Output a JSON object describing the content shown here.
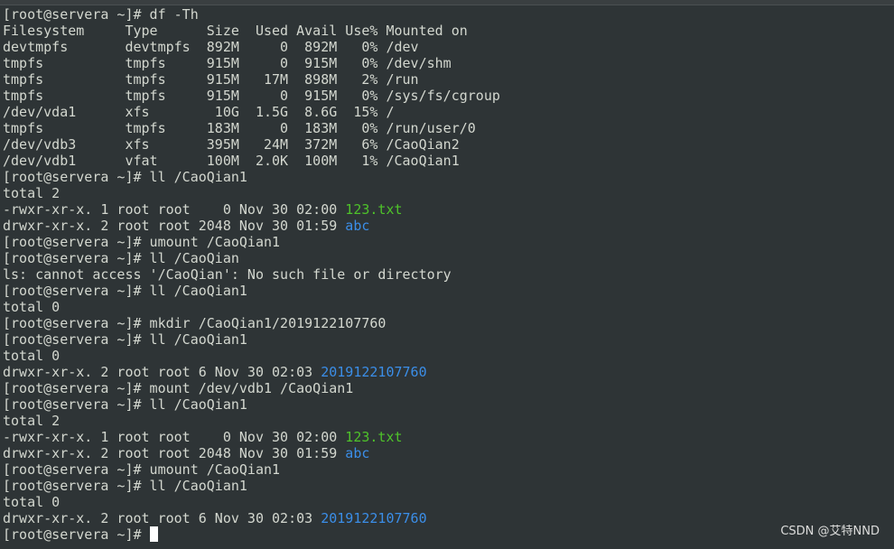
{
  "terminal": {
    "colors": {
      "background": "#2e3436",
      "text": "#d3d7cf",
      "executable_file": "#4ec22a",
      "directory": "#3b8ee8",
      "cursor": "#ffffff"
    },
    "lines": [
      "[root@servera ~]# df -Th",
      "Filesystem     Type      Size  Used Avail Use% Mounted on",
      "devtmpfs       devtmpfs  892M     0  892M   0% /dev",
      "tmpfs          tmpfs     915M     0  915M   0% /dev/shm",
      "tmpfs          tmpfs     915M   17M  898M   2% /run",
      "tmpfs          tmpfs     915M     0  915M   0% /sys/fs/cgroup",
      "/dev/vda1      xfs        10G  1.5G  8.6G  15% /",
      "tmpfs          tmpfs     183M     0  183M   0% /run/user/0",
      "/dev/vdb3      xfs       395M   24M  372M   6% /CaoQian2",
      "/dev/vdb1      vfat      100M  2.0K  100M   1% /CaoQian1",
      "[root@servera ~]# ll /CaoQian1",
      "total 2",
      "-rwxr-xr-x. 1 root root    0 Nov 30 02:00 ",
      "drwxr-xr-x. 2 root root 2048 Nov 30 01:59 ",
      "[root@servera ~]# umount /CaoQian1",
      "[root@servera ~]# ll /CaoQian",
      "ls: cannot access '/CaoQian': No such file or directory",
      "[root@servera ~]# ll /CaoQian1",
      "total 0",
      "[root@servera ~]# mkdir /CaoQian1/2019122107760",
      "[root@servera ~]# ll /CaoQian1",
      "total 0",
      "drwxr-xr-x. 2 root root 6 Nov 30 02:03 ",
      "[root@servera ~]# mount /dev/vdb1 /CaoQian1",
      "[root@servera ~]# ll /CaoQian1",
      "total 2",
      "-rwxr-xr-x. 1 root root    0 Nov 30 02:00 ",
      "drwxr-xr-x. 2 root root 2048 Nov 30 01:59 ",
      "[root@servera ~]# umount /CaoQian1",
      "[root@servera ~]# ll /CaoQian1",
      "total 0",
      "drwxr-xr-x. 2 root root 6 Nov 30 02:03 ",
      "[root@servera ~]# "
    ],
    "colored_names": {
      "line_12": "123.txt",
      "line_13": "abc",
      "line_22": "2019122107760",
      "line_26": "123.txt",
      "line_27": "abc",
      "line_31": "2019122107760"
    }
  },
  "watermark": {
    "text": "CSDN @艾特NND"
  }
}
